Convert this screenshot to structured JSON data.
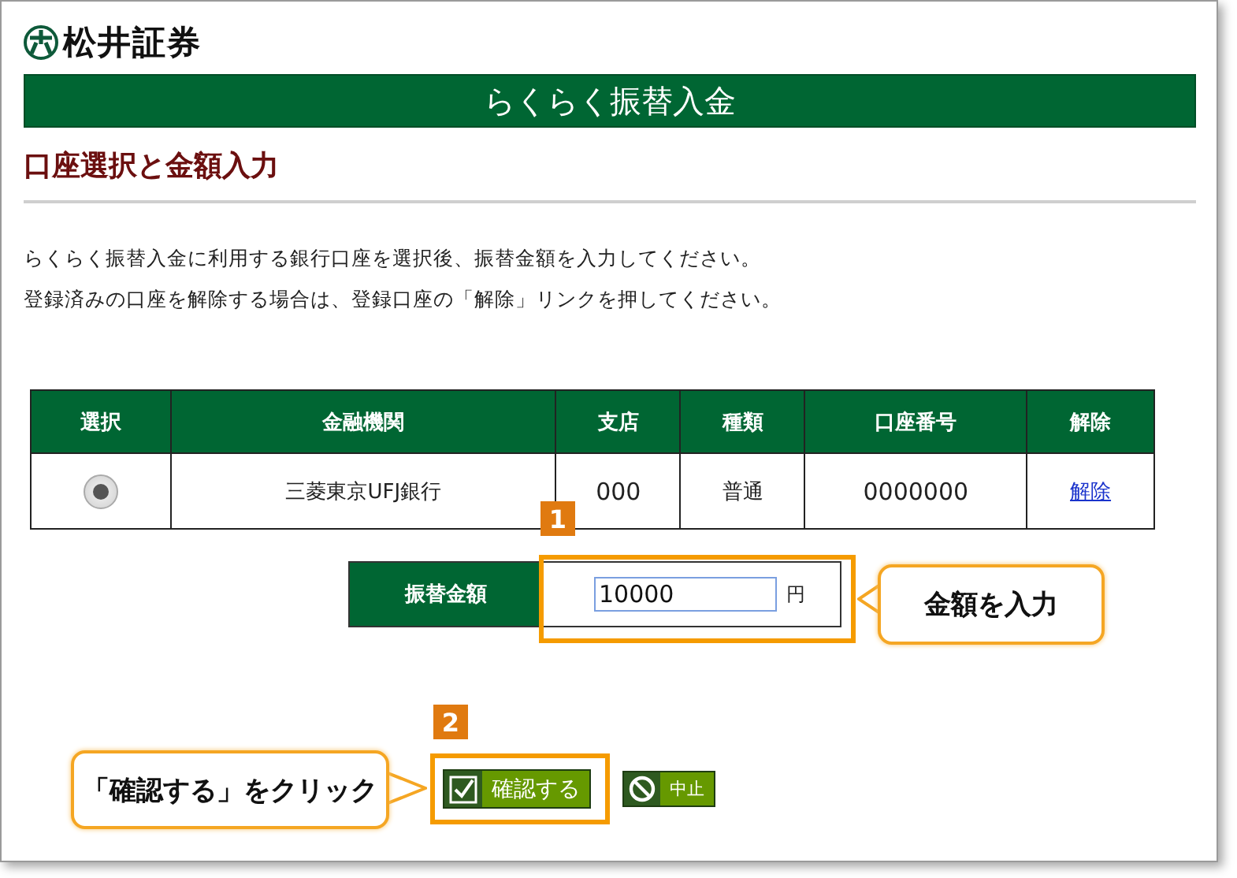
{
  "brand": {
    "name": "松井証券"
  },
  "banner": {
    "title": "らくらく振替入金"
  },
  "heading": "口座選択と金額入力",
  "instructions": [
    "らくらく振替入金に利用する銀行口座を選択後、振替金額を入力してください。",
    "登録済みの口座を解除する場合は、登録口座の「解除」リンクを押してください。"
  ],
  "table": {
    "columns": [
      "選択",
      "金融機関",
      "支店",
      "種類",
      "口座番号",
      "解除"
    ],
    "rows": [
      {
        "selected": true,
        "bank": "三菱東京UFJ銀行",
        "branch": "000",
        "type": "普通",
        "account_number": "0000000",
        "action": "解除"
      }
    ]
  },
  "amount": {
    "label": "振替金額",
    "value": "10000",
    "unit": "円"
  },
  "buttons": [
    {
      "kind": "confirm",
      "label": "確認する"
    },
    {
      "kind": "cancel",
      "label": "中止"
    }
  ],
  "annotations": [
    {
      "number": "1",
      "text": "金額を入力"
    },
    {
      "number": "2",
      "text": "「確認する」をクリック"
    }
  ]
}
